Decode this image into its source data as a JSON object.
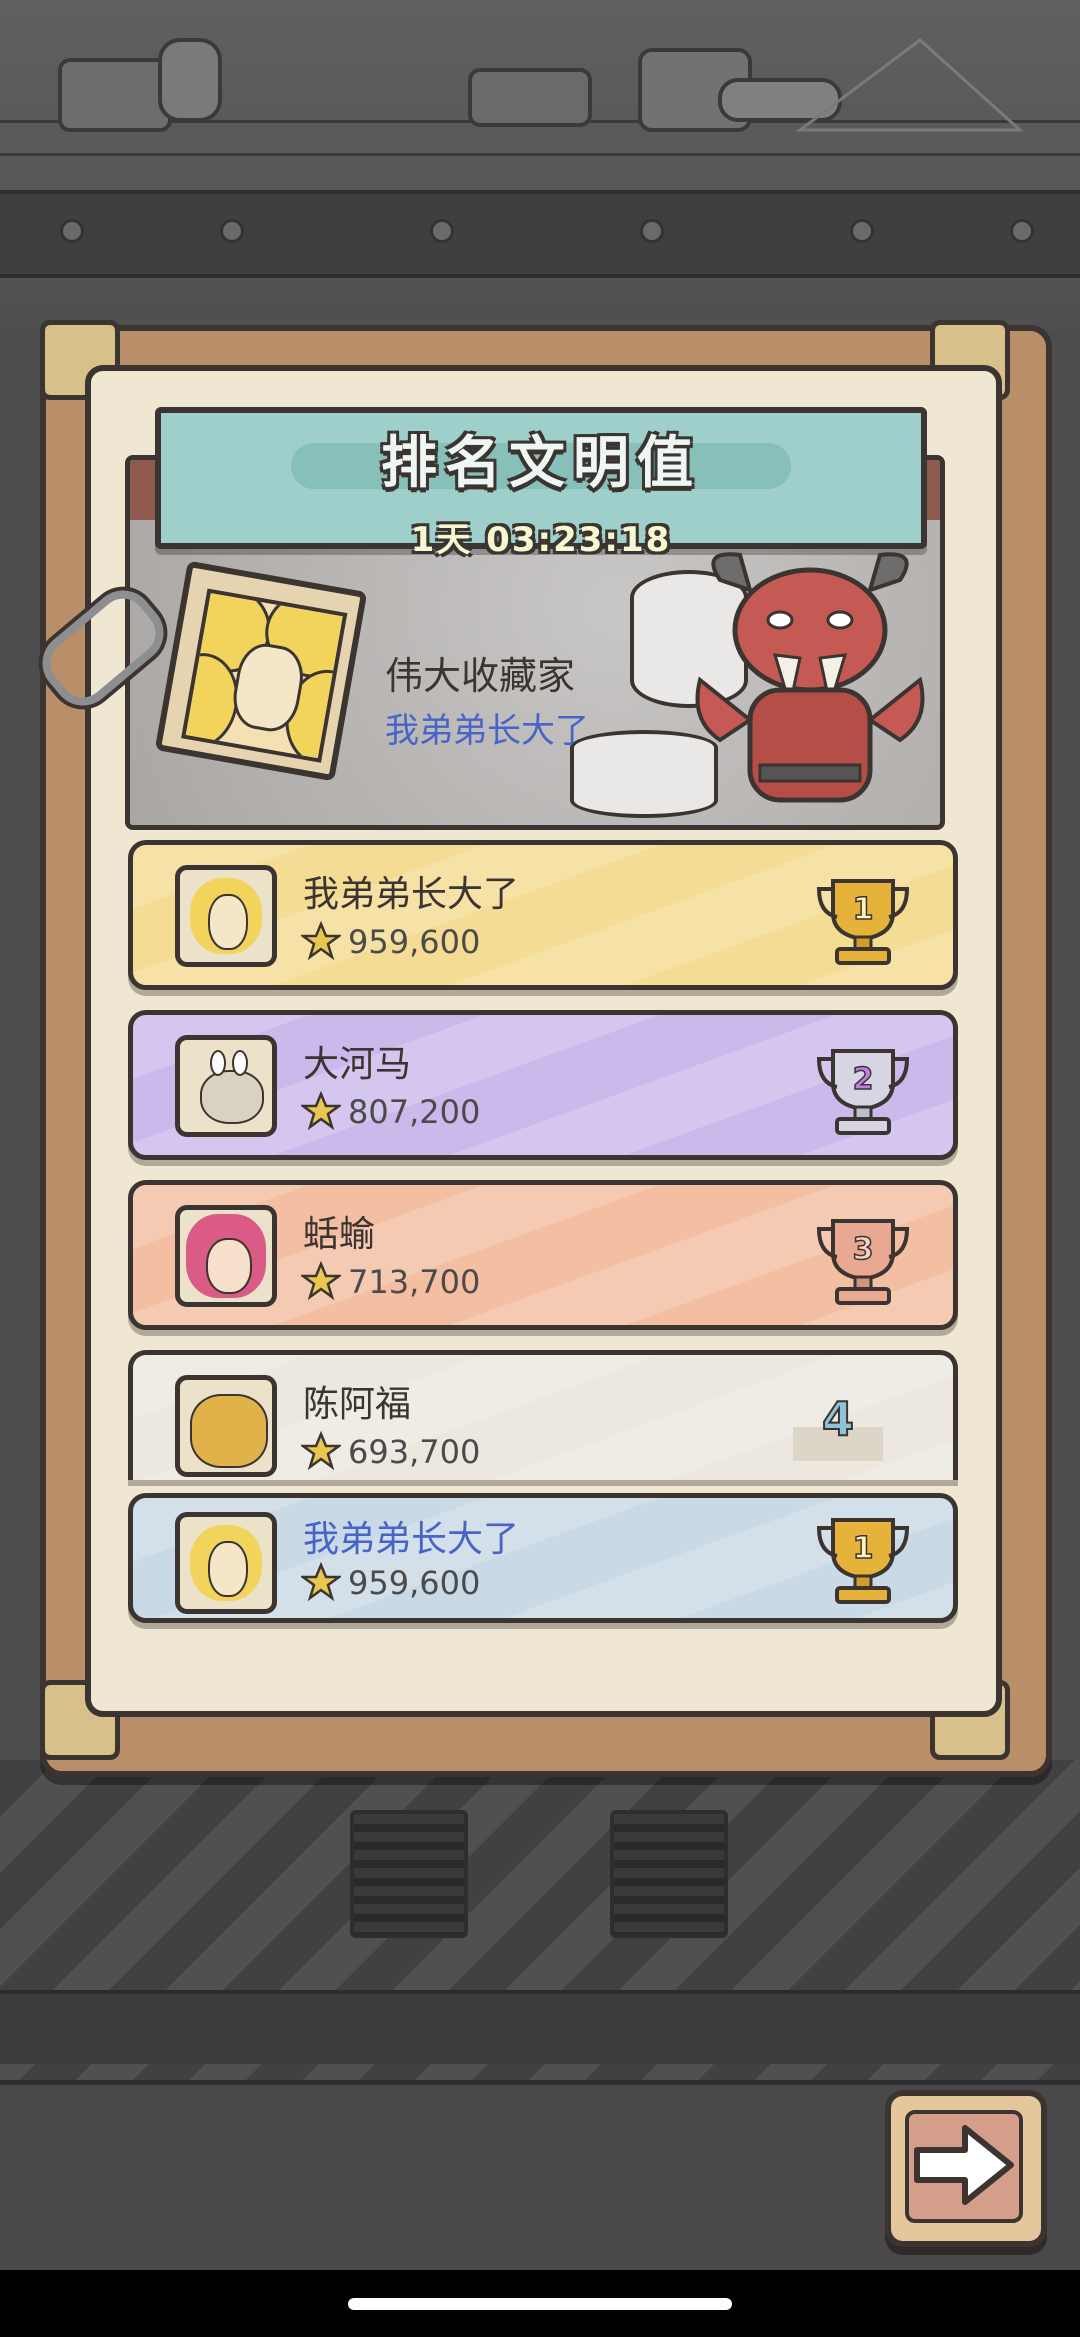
{
  "header": {
    "title": "排名文明值",
    "timer": "1天 03:23:18"
  },
  "collector": {
    "title": "伟大收藏家",
    "name": "我弟弟长大了"
  },
  "rankings": [
    {
      "name": "我弟弟长大了",
      "score": "959,600",
      "rank": "1",
      "color": "#f4dc94"
    },
    {
      "name": "大河马",
      "score": "807,200",
      "rank": "2",
      "color": "#cbb9ec"
    },
    {
      "name": "蛞蝓",
      "score": "713,700",
      "rank": "3",
      "color": "#f3bea2"
    },
    {
      "name": "陈阿福",
      "score": "693,700",
      "rank": "4",
      "color": "#ece8e0"
    }
  ],
  "me": {
    "name": "我弟弟长大了",
    "score": "959,600",
    "rank": "1",
    "color": "#c9d9e5"
  },
  "colors": {
    "accent_name": "#4864c8",
    "frame": "#b88f68",
    "panel": "#efe7d2",
    "title_plate": "#9fcfcb"
  },
  "icons": [
    "paperclip-icon",
    "star-icon",
    "trophy-icon",
    "arrow-right-icon"
  ]
}
